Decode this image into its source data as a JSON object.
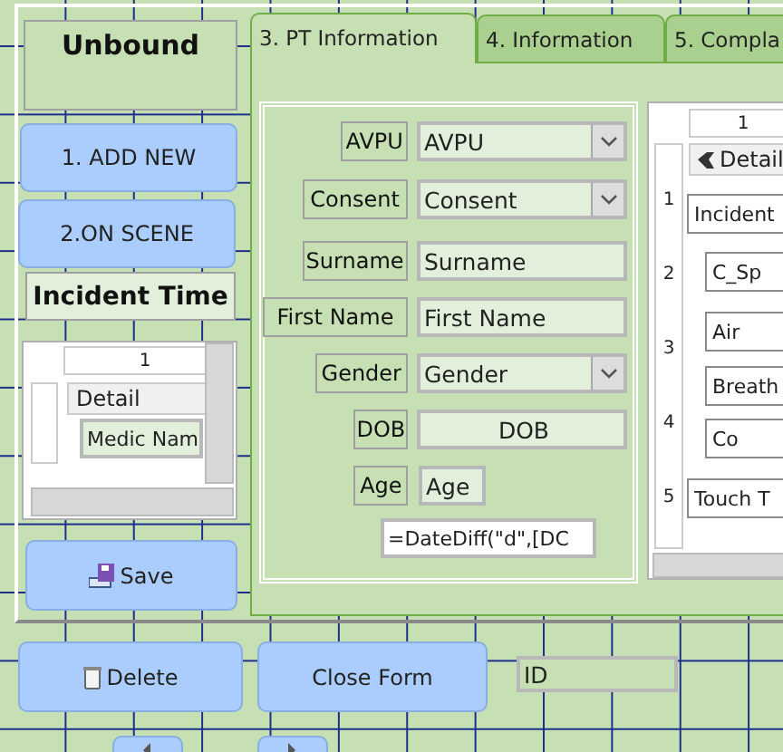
{
  "header_label": "Unbound",
  "nav_buttons": [
    {
      "label": "1. ADD NEW"
    },
    {
      "label": "2.ON SCENE"
    }
  ],
  "incident_time_label": "Incident Time",
  "medic_subform": {
    "ruler": [
      "1"
    ],
    "section": "Detail",
    "field": "Medic Nam"
  },
  "save_button": "Save",
  "tabs": [
    {
      "label": "3. PT Information",
      "selected": true
    },
    {
      "label": "4. Information",
      "selected": false
    },
    {
      "label": "5. Compla",
      "selected": false
    }
  ],
  "fields": [
    {
      "label": "AVPU",
      "kind": "combo",
      "value": "AVPU"
    },
    {
      "label": "Consent",
      "kind": "combo",
      "value": "Consent"
    },
    {
      "label": "Surname",
      "kind": "text",
      "value": "Surname"
    },
    {
      "label": "First Name",
      "kind": "text",
      "value": "First Name"
    },
    {
      "label": "Gender",
      "kind": "combo",
      "value": "Gender"
    },
    {
      "label": "DOB",
      "kind": "centered",
      "value": "DOB"
    },
    {
      "label": "Age",
      "kind": "short",
      "value": "Age"
    }
  ],
  "age_formula": "=DateDiff(\"d\",[DC",
  "complaint_subform": {
    "ruler": [
      "1"
    ],
    "section": "Detail",
    "side_ruler": [
      "1",
      "2",
      "3",
      "4",
      "5"
    ],
    "controls": [
      "Incident",
      "C_Sp",
      "Air",
      "Breath",
      "Co",
      "Touch T"
    ]
  },
  "bottom_buttons": [
    {
      "label": "Delete"
    },
    {
      "label": "Close Form"
    }
  ],
  "id_field": "ID"
}
